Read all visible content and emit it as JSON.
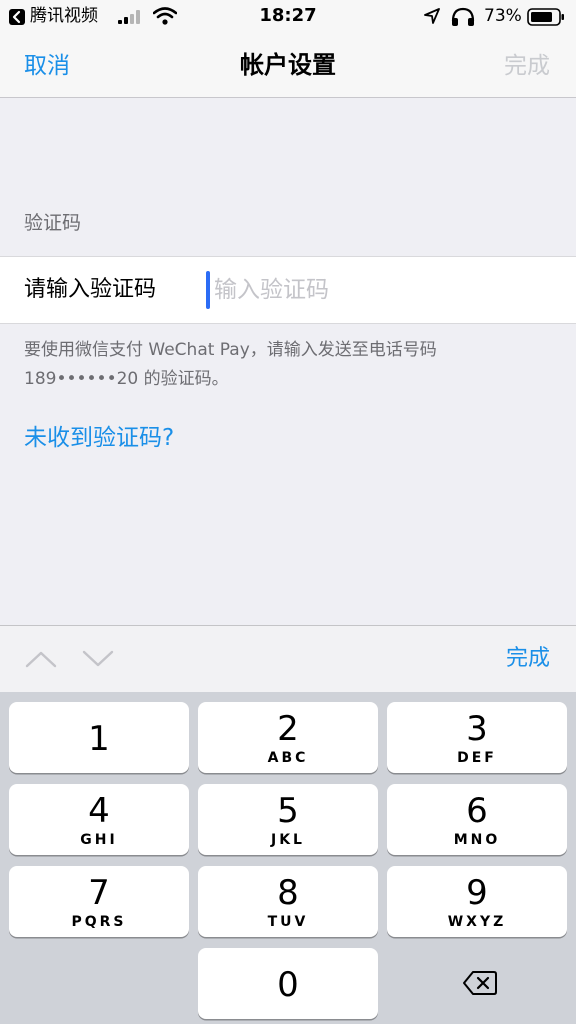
{
  "status_bar": {
    "back_app": "腾讯视频",
    "time": "18:27",
    "battery_percent": "73%",
    "icons": [
      "back-arrow-icon",
      "signal-icon",
      "wifi-icon",
      "location-icon",
      "headphone-icon",
      "battery-icon"
    ]
  },
  "nav": {
    "cancel_label": "取消",
    "title": "帐户设置",
    "done_label": "完成"
  },
  "form": {
    "section_header": "验证码",
    "field_label": "请输入验证码",
    "field_value": "",
    "field_placeholder": "输入验证码",
    "footer_line1": "要使用微信支付 WeChat Pay，请输入发送至电话号码",
    "footer_line2": "189••••••20 的验证码。",
    "resend_link": "未收到验证码?"
  },
  "accessory": {
    "done_label": "完成",
    "icons": [
      "chevron-up-icon",
      "chevron-down-icon"
    ]
  },
  "keypad": {
    "keys": [
      {
        "num": "1",
        "letters": ""
      },
      {
        "num": "2",
        "letters": "ABC"
      },
      {
        "num": "3",
        "letters": "DEF"
      },
      {
        "num": "4",
        "letters": "GHI"
      },
      {
        "num": "5",
        "letters": "JKL"
      },
      {
        "num": "6",
        "letters": "MNO"
      },
      {
        "num": "7",
        "letters": "PQRS"
      },
      {
        "num": "8",
        "letters": "TUV"
      },
      {
        "num": "9",
        "letters": "WXYZ"
      },
      {
        "num": "0",
        "letters": ""
      }
    ],
    "delete_icon": "backspace-icon"
  },
  "colors": {
    "accent": "#1a8fe8",
    "disabled": "#c9cbcf",
    "background": "#efeff4",
    "keypad_bg": "#cfd2d8",
    "caret": "#2b6cf5"
  }
}
